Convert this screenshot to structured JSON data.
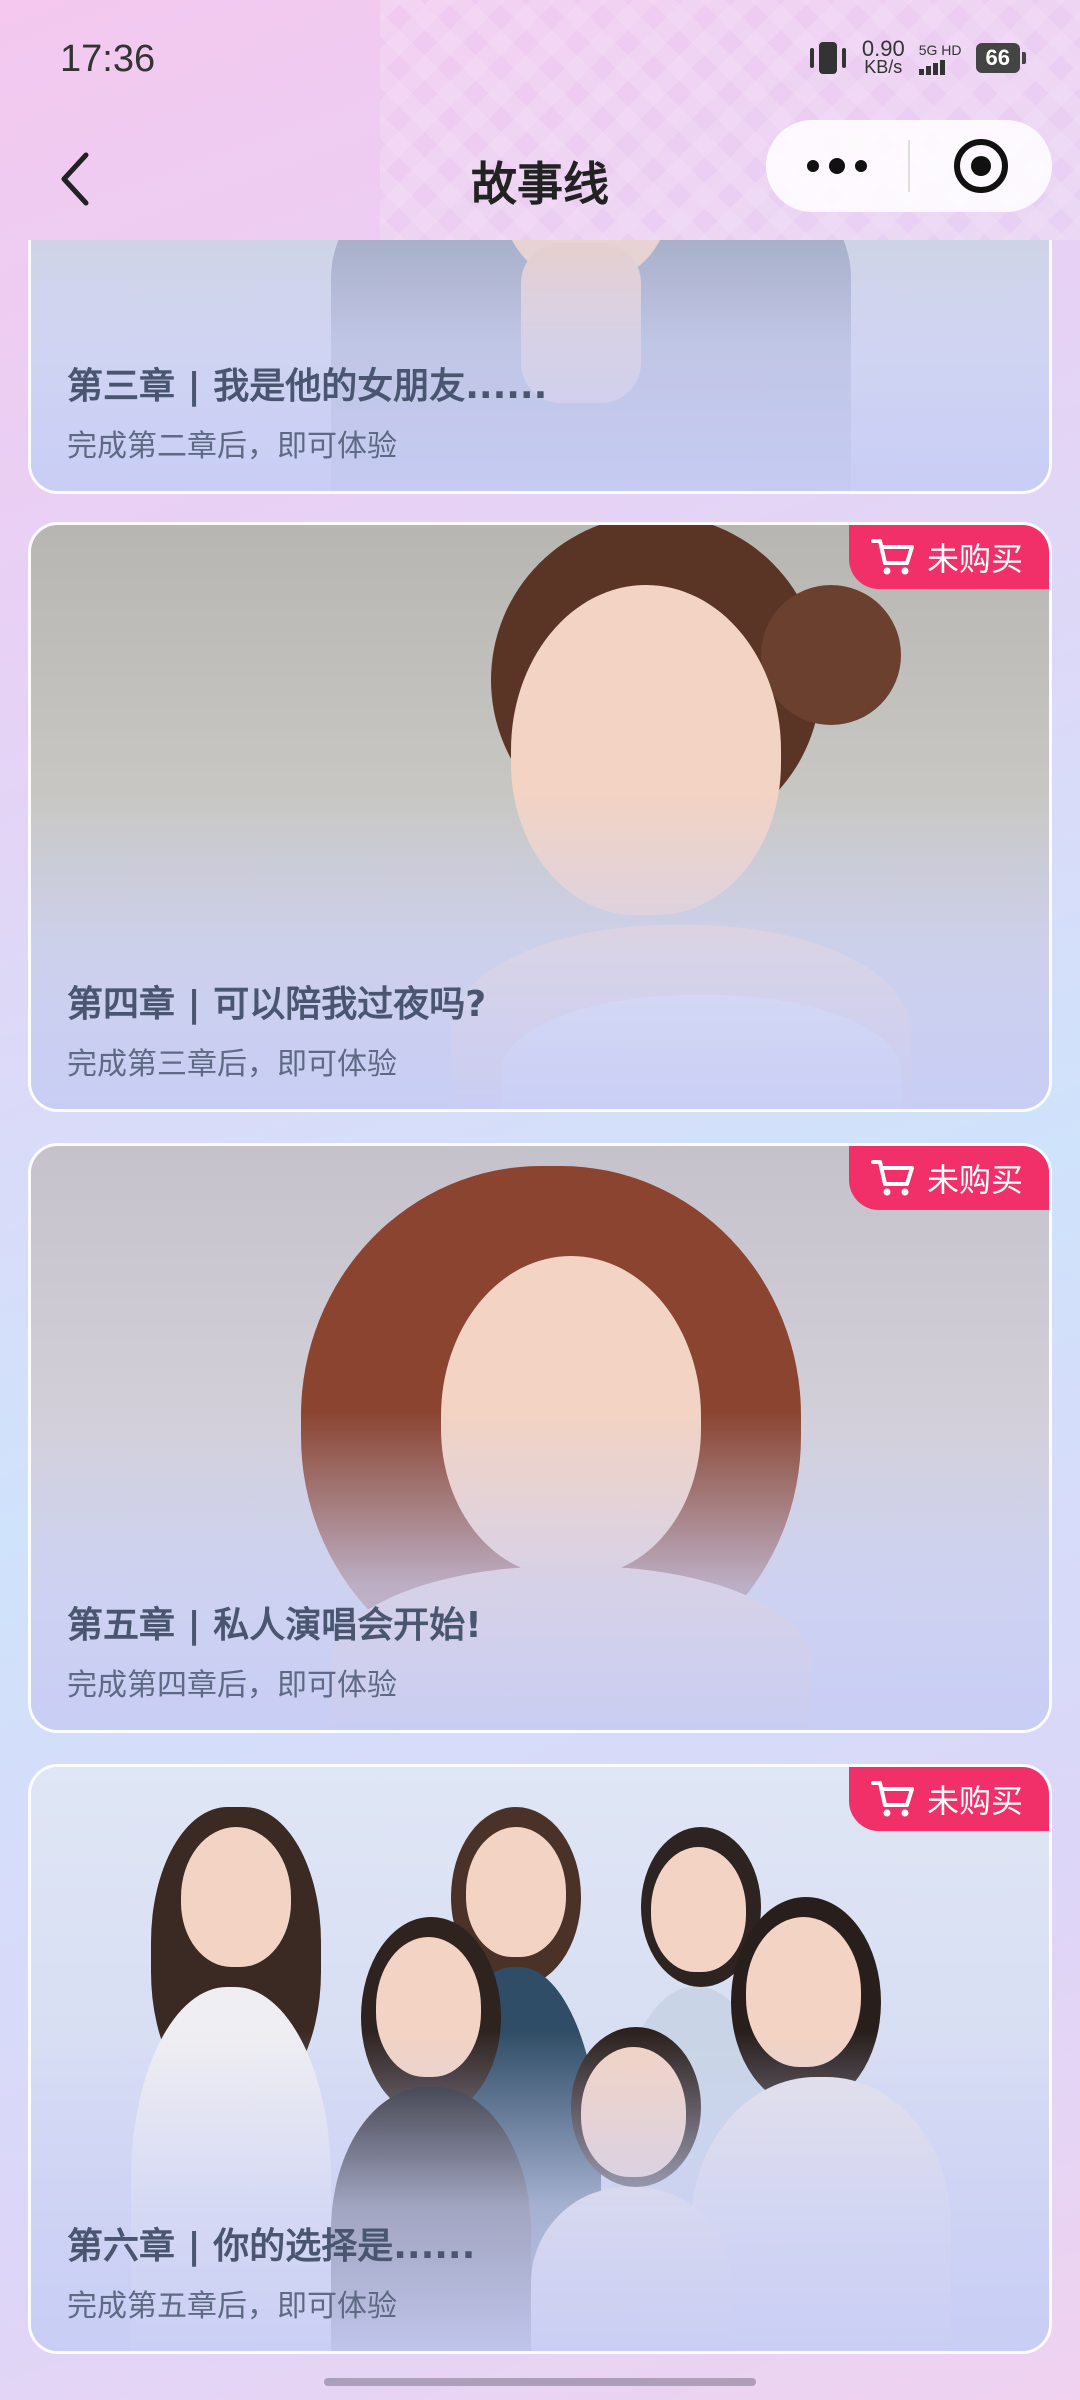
{
  "status_bar": {
    "time": "17:36",
    "net_speed_value": "0.90",
    "net_speed_unit": "KB/s",
    "signal_label": "5G HD",
    "battery": "66"
  },
  "nav": {
    "title": "故事线"
  },
  "chapters": [
    {
      "title": "第三章 | 我是他的女朋友......",
      "subtitle": "完成第二章后，即可体验",
      "badge": ""
    },
    {
      "title": "第四章 | 可以陪我过夜吗?",
      "subtitle": "完成第三章后，即可体验",
      "badge": "未购买"
    },
    {
      "title": "第五章 | 私人演唱会开始!",
      "subtitle": "完成第四章后，即可体验",
      "badge": "未购买"
    },
    {
      "title": "第六章 | 你的选择是......",
      "subtitle": "完成第五章后，即可体验",
      "badge": "未购买"
    }
  ],
  "colors": {
    "badge": "#f1306a",
    "title_text": "#4a5670",
    "subtitle_text": "#5e6a84"
  },
  "icons": [
    "vibrate-icon",
    "signal-icon",
    "battery-icon",
    "back-icon",
    "more-icon",
    "close-target-icon",
    "cart-icon"
  ]
}
